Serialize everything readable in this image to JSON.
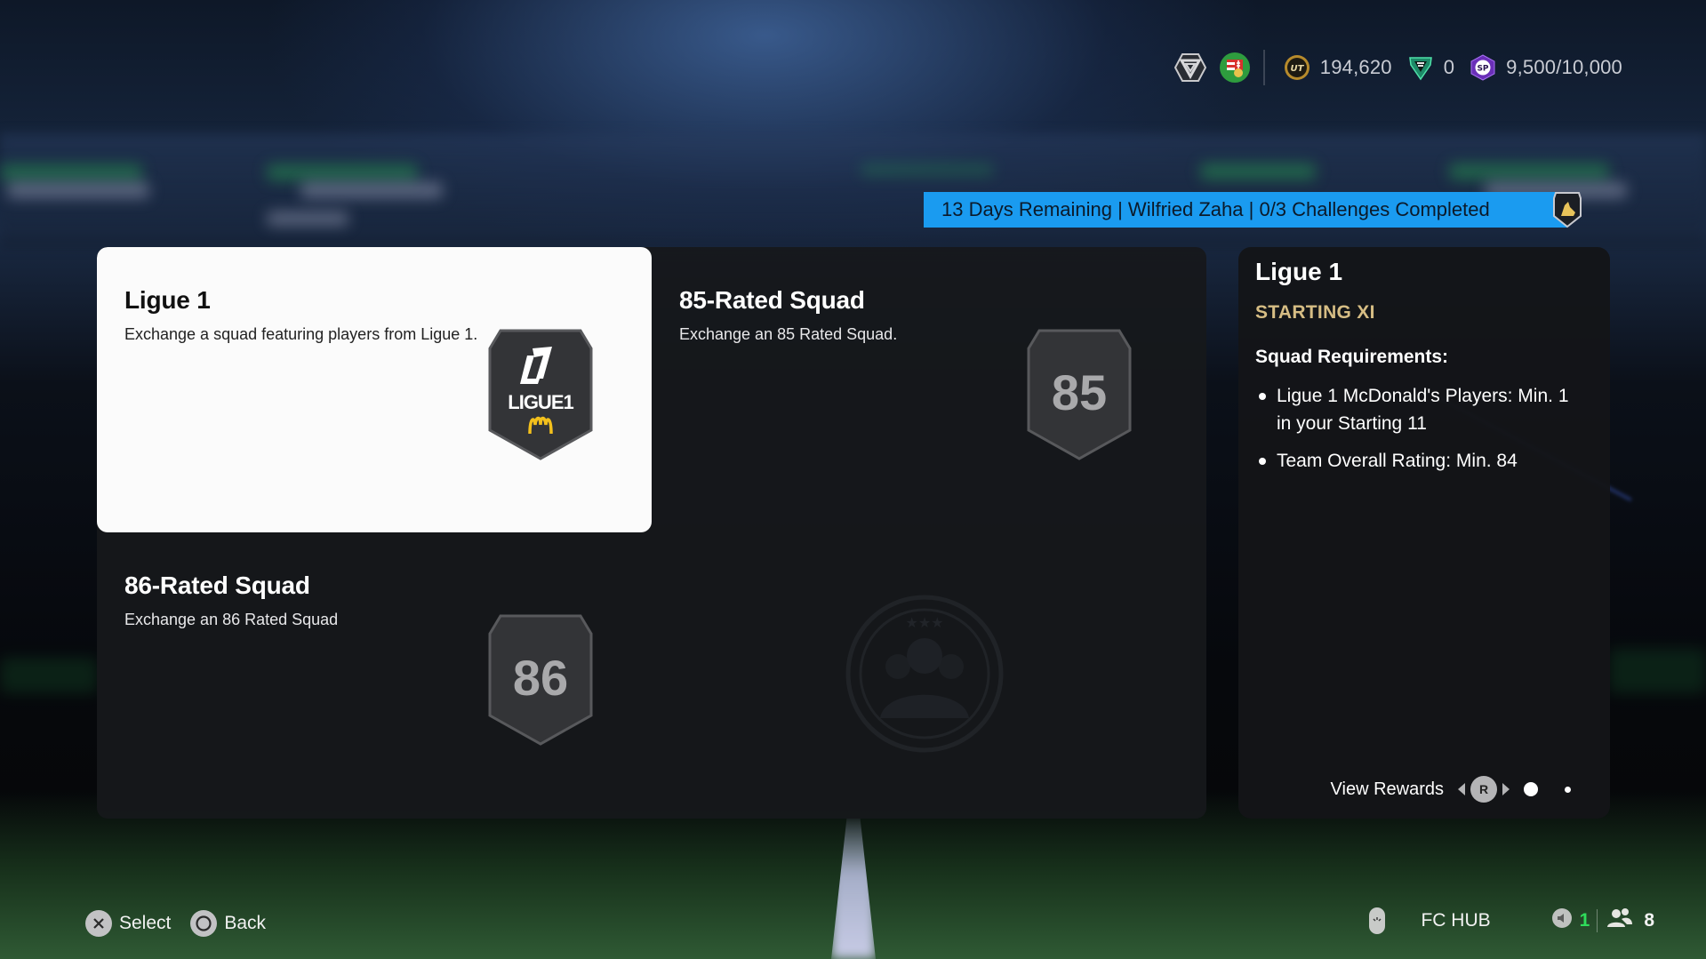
{
  "currency_bar": {
    "division_icon": "division-rank-icon",
    "club_badge_icon": "hungary-club-badge-icon",
    "coins": {
      "icon": "ut-coin-icon",
      "value": "194,620"
    },
    "fc_points": {
      "icon": "fc-points-icon",
      "value": "0"
    },
    "season_points": {
      "icon": "sp-season-points-icon",
      "value": "9,500/10,000"
    }
  },
  "objective_banner": {
    "text": "13 Days Remaining | Wilfried Zaha | 0/3 Challenges Completed",
    "color": "#1a9bf0",
    "badge_icon": "player-reward-badge-icon"
  },
  "challenges": [
    {
      "title": "Ligue 1",
      "description": "Exchange a squad featuring players from Ligue 1.",
      "badge": {
        "type": "league-logo",
        "text": "LIGUE1",
        "mark": "L1",
        "sponsor": "M"
      },
      "selected": true
    },
    {
      "title": "85-Rated Squad",
      "description": "Exchange an 85 Rated Squad.",
      "badge": {
        "type": "rating",
        "text": "85"
      },
      "selected": false
    },
    {
      "title": "86-Rated Squad",
      "description": "Exchange an 86 Rated Squad",
      "badge": {
        "type": "rating",
        "text": "86"
      },
      "selected": false
    }
  ],
  "detail_panel": {
    "title": "Ligue 1",
    "subtitle": "STARTING XI",
    "requirements_heading": "Squad Requirements:",
    "requirements": [
      "Ligue 1 McDonald's Players: Min. 1 in your Starting 11",
      "Team Overall Rating: Min. 84"
    ],
    "view_rewards_label": "View Rewards",
    "rewards_button": "R",
    "rewards_page": 1,
    "rewards_page_count": 2,
    "accent_color": "#d6bd84"
  },
  "footer": {
    "select_label": "Select",
    "back_label": "Back",
    "hub_label": "FC HUB",
    "notifications_count": "1",
    "friends_count": "8"
  }
}
